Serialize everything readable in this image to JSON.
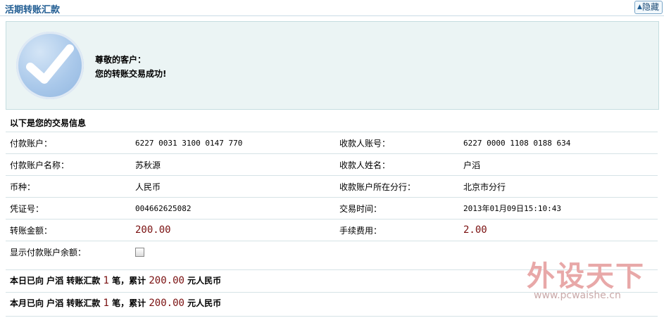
{
  "header": {
    "title": "活期转账汇款",
    "hide_button": "隐藏"
  },
  "success": {
    "greeting": "尊敬的客户：",
    "message": "您的转账交易成功!"
  },
  "section_title": "以下是您的交易信息",
  "rows": [
    {
      "l1": "付款账户：",
      "v1": "6227 0031 3100 0147 770",
      "l2": "收款人账号：",
      "v2": "6227 0000 1108 0188 634"
    },
    {
      "l1": "付款账户名称：",
      "v1": "苏秋源",
      "l2": "收款人姓名：",
      "v2": "户滔"
    },
    {
      "l1": "币种：",
      "v1": "人民币",
      "l2": "收款账户所在分行：",
      "v2": "北京市分行"
    },
    {
      "l1": "凭证号：",
      "v1": "004662625082",
      "l2": "交易时间：",
      "v2": "2013年01月09日15:10:43"
    },
    {
      "l1": "转账金额：",
      "v1": "200.00",
      "l2": "手续费用：",
      "v2": "2.00"
    }
  ],
  "show_balance_label": "显示付款账户余额：",
  "summary_day": {
    "prefix": "本日已向 户滔 转账汇款",
    "count": "1",
    "mid": "笔，累计",
    "amount": "200.00",
    "suffix": "元人民币"
  },
  "summary_month": {
    "prefix": "本月已向 户滔 转账汇款",
    "count": "1",
    "mid": "笔，累计",
    "amount": "200.00",
    "suffix": "元人民币"
  },
  "watermark": {
    "logo": "外设天下",
    "url": "www.pcwaishe.cn"
  }
}
